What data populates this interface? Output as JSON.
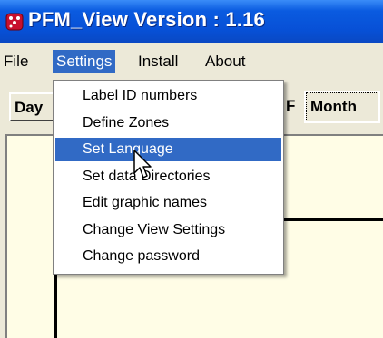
{
  "window": {
    "title": "PFM_View Version :  1.16",
    "icon": "app-dice-icon"
  },
  "menubar": {
    "items": [
      {
        "label": "File"
      },
      {
        "label": "Settings"
      },
      {
        "label": "Install"
      },
      {
        "label": "About"
      }
    ],
    "active": "Settings"
  },
  "toolbar": {
    "left_partial": "Day",
    "right_partial": "F",
    "month_label": "Month"
  },
  "settings_menu": {
    "items": [
      {
        "label": "Label ID numbers"
      },
      {
        "label": "Define Zones"
      },
      {
        "label": "Set Language"
      },
      {
        "label": "Set data Directories"
      },
      {
        "label": "Edit graphic names"
      },
      {
        "label": "Change View Settings"
      },
      {
        "label": "Change password"
      }
    ],
    "highlighted": "Set Language"
  },
  "colors": {
    "titlebar": "#0750d6",
    "menu_highlight": "#316ac5",
    "panel_bg": "#fffde6",
    "chrome_bg": "#ece9d8"
  }
}
